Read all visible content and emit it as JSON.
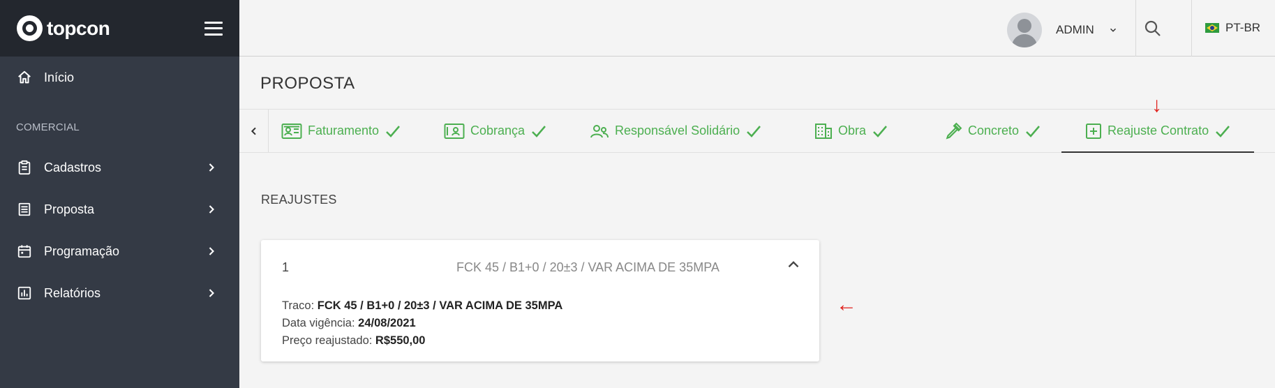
{
  "brand": {
    "name": "topcon"
  },
  "sidebar": {
    "home_label": "Início",
    "section_label": "COMERCIAL",
    "items": [
      {
        "label": "Cadastros",
        "icon": "clipboard-icon"
      },
      {
        "label": "Proposta",
        "icon": "list-icon"
      },
      {
        "label": "Programação",
        "icon": "calendar-icon"
      },
      {
        "label": "Relatórios",
        "icon": "chart-icon"
      }
    ]
  },
  "topbar": {
    "user_name": "ADMIN",
    "language": "PT-BR"
  },
  "page": {
    "title": "PROPOSTA",
    "section_title": "REAJUSTES"
  },
  "tabs": [
    {
      "label": "Faturamento",
      "icon": "id-card-icon",
      "status": "done"
    },
    {
      "label": "Cobrança",
      "icon": "contact-card-icon",
      "status": "done"
    },
    {
      "label": "Responsável Solidário",
      "icon": "users-icon",
      "status": "done"
    },
    {
      "label": "Obra",
      "icon": "building-icon",
      "status": "done"
    },
    {
      "label": "Concreto",
      "icon": "eyedropper-icon",
      "status": "done"
    },
    {
      "label": "Reajuste Contrato",
      "icon": "plus-box-icon",
      "status": "done",
      "active": true
    }
  ],
  "card": {
    "number": "1",
    "summary": "FCK 45 / B1+0 / 20±3 / VAR ACIMA DE 35MPA",
    "traco_label": "Traco:",
    "traco_value": "FCK 45 / B1+0 / 20±3 / VAR ACIMA DE 35MPA",
    "data_label": "Data vigência:",
    "data_value": "24/08/2021",
    "preco_label": "Preço reajustado:",
    "preco_value": "R$550,00"
  },
  "annotations": {
    "down_arrow": "↓",
    "left_arrow": "←"
  },
  "colors": {
    "accent": "#4caf50",
    "sidebar": "#343a45",
    "sidebar_head": "#23272e",
    "annotation": "#e0201b"
  }
}
